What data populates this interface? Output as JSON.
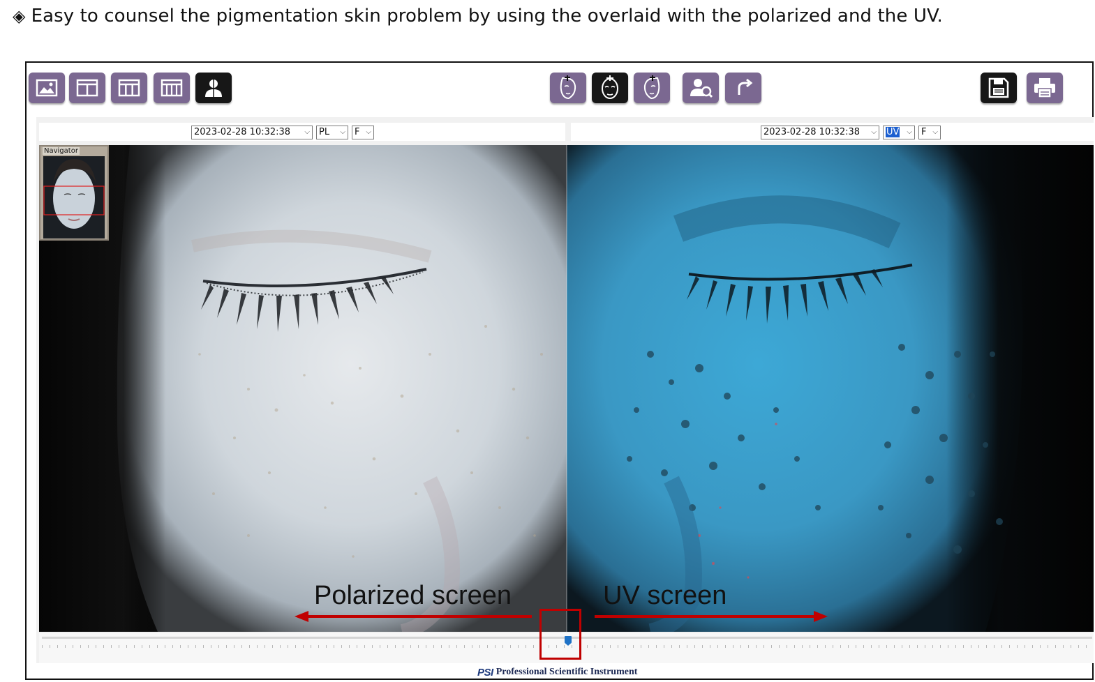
{
  "caption": {
    "bullet": "◈",
    "text": "Easy to counsel the pigmentation skin problem by using the overlaid with the polarized and the UV."
  },
  "toolbar": {
    "left_buttons": [
      {
        "icon": "single-image-icon"
      },
      {
        "icon": "two-split-icon"
      },
      {
        "icon": "three-split-icon"
      },
      {
        "icon": "four-split-icon"
      },
      {
        "icon": "overlay-person-icon",
        "active": true
      }
    ],
    "center_buttons": [
      {
        "icon": "face-left-icon"
      },
      {
        "icon": "face-front-icon",
        "active": true
      },
      {
        "icon": "face-right-icon"
      },
      {
        "icon": "zoom-person-icon"
      },
      {
        "icon": "redo-icon"
      }
    ],
    "right_buttons": [
      {
        "icon": "save-icon"
      },
      {
        "icon": "print-icon"
      }
    ]
  },
  "left_panel": {
    "date": "2023-02-28 10:32:38",
    "mode": "PL",
    "view": "F"
  },
  "right_panel": {
    "date": "2023-02-28 10:32:38",
    "mode": "UV",
    "view": "F"
  },
  "navigator": {
    "label": "Navigator"
  },
  "overlay": {
    "left_label": "Polarized screen",
    "right_label": "UV screen",
    "split_position": 0.5
  },
  "colors": {
    "accent": "#7b6891",
    "active": "#171717",
    "highlight": "#c00000",
    "uv_tint": "#3aa7d6"
  },
  "footer": {
    "logo": "PSI",
    "company": "Professional Scientific Instrument"
  }
}
